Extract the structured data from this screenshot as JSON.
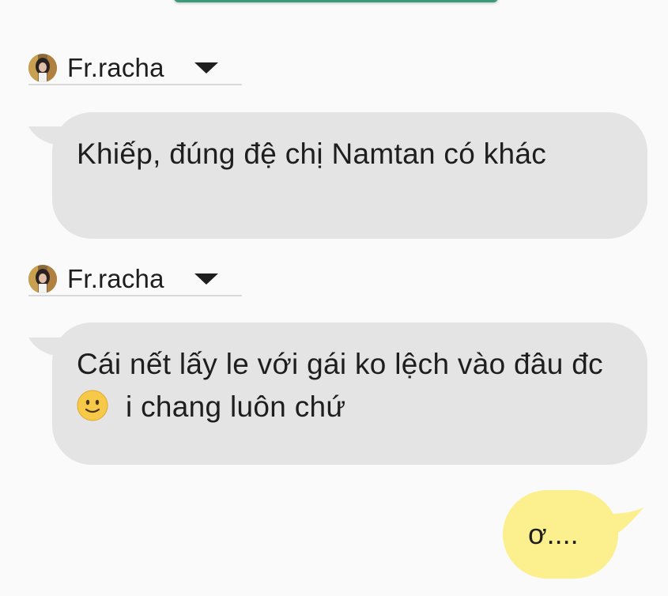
{
  "messages": [
    {
      "sender": "Fr.racha",
      "text": "Khiếp, đúng đệ chị Namtan có khác"
    },
    {
      "sender": "Fr.racha",
      "text_before_emoji": "Cái nết lấy le với gái ko lệch vào đâu đc",
      "emoji": "slightly-smiling-face",
      "text_after_emoji": "i chang luôn chứ"
    }
  ],
  "own_message": {
    "text": "ơ...."
  },
  "colors": {
    "incoming_bubble": "#e4e4e4",
    "outgoing_bubble": "#fbef8e",
    "background": "#fafafa",
    "accent": "#3a9a7a"
  }
}
